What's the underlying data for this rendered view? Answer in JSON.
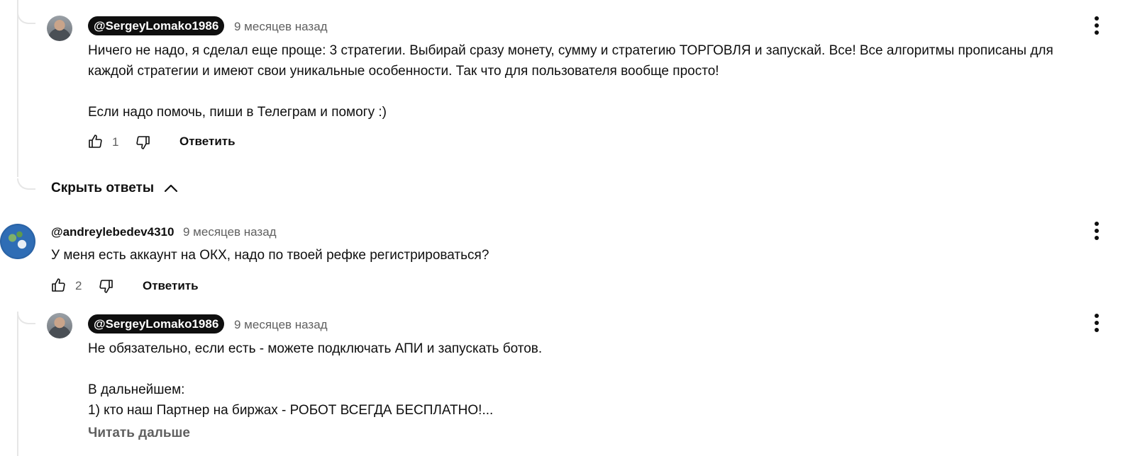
{
  "comments": [
    {
      "author": "@SergeyLomako1986",
      "author_is_creator": true,
      "time": "9 месяцев назад",
      "text": "Ничего не надо, я сделал еще проще: 3 стратегии. Выбирай сразу монету, сумму и стратегию ТОРГОВЛЯ и запускай. Все! Все алгоритмы прописаны для\nкаждой стратегии и имеют свои уникальные особенности. Так что для пользователя вообще просто!\n\nЕсли надо помочь, пиши в Телеграм и помогу :)",
      "likes": "1",
      "reply_label": "Ответить"
    },
    {
      "author": "@andreylebedev4310",
      "author_is_creator": false,
      "time": "9 месяцев назад",
      "text": "У меня есть аккаунт на ОКХ, надо по твоей рефке регистрироваться?",
      "likes": "2",
      "reply_label": "Ответить"
    },
    {
      "author": "@SergeyLomako1986",
      "author_is_creator": true,
      "time": "9 месяцев назад",
      "text": "Не обязательно, если есть - можете подключать АПИ и запускать ботов.\n\nВ дальнейшем:\n1) кто наш Партнер на биржах - РОБОТ ВСЕГДА БЕСПЛАТНО!...",
      "read_more": "Читать дальше"
    }
  ],
  "hide_replies_label": "Скрыть ответы",
  "icons": {
    "like": "thumbs-up-icon",
    "dislike": "thumbs-down-icon",
    "menu": "more-vert-icon",
    "collapse": "chevron-up-icon"
  },
  "colors": {
    "text": "#0f0f0f",
    "secondary": "#606060",
    "badge_bg": "#0f0f0f",
    "badge_text": "#ffffff",
    "thread_line": "#e6e6e6"
  }
}
